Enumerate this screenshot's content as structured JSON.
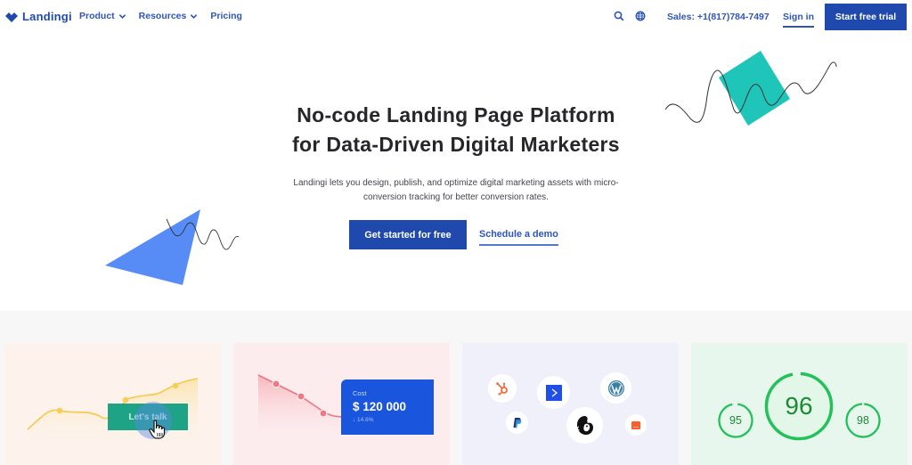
{
  "nav": {
    "brand": "Landingi",
    "links": [
      {
        "label": "Product",
        "has_dropdown": true
      },
      {
        "label": "Resources",
        "has_dropdown": true
      },
      {
        "label": "Pricing",
        "has_dropdown": false
      }
    ],
    "search_icon": "search-icon",
    "language_icon": "globe-icon",
    "sales_phone": "Sales: +1(817)784-7497",
    "sign_in": "Sign in",
    "start_trial": "Start free trial"
  },
  "hero": {
    "title_line1_light": "No-code ",
    "title_line1_bold": "Landing Page Platform",
    "title_line2_light": "for Data-Driven ",
    "title_line2_bold": "Digital Marketers",
    "subtitle_line1": "Landingi lets you design, publish, and optimize digital marketing assets with micro-",
    "subtitle_line2": "conversion tracking for better conversion rates.",
    "cta_primary": "Get started for free",
    "cta_secondary": "Schedule a demo"
  },
  "cards": {
    "talk": {
      "button_label": "Let's talk"
    },
    "cost": {
      "label": "Cost",
      "value": "$ 120 000",
      "change": "↓ 14.6%"
    },
    "integrations": {
      "icons": [
        "hubspot-icon",
        "activecampaign-icon",
        "wordpress-icon",
        "paypal-icon",
        "mailchimp-icon",
        "other-app-icon"
      ]
    },
    "scores": {
      "left": "95",
      "center": "96",
      "right": "98"
    }
  },
  "colors": {
    "brand": "#2049ad",
    "link": "#2e55b8",
    "teal": "#1fc5b9",
    "triangle_blue": "#578cf6",
    "talk_green": "#1ea386",
    "cost_blue": "#1a55de",
    "score_green": "#22c15a"
  }
}
